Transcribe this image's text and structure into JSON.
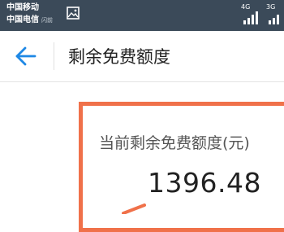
{
  "status_bar": {
    "carrier_1": "中国移动",
    "carrier_2": "中国电信",
    "carrier_2_tag": "闪前",
    "network_1": "4G",
    "network_2": "3G",
    "gallery_icon": "image-icon"
  },
  "header": {
    "back_icon": "back-arrow-icon",
    "title": "剩余免费额度"
  },
  "balance": {
    "label": "当前剩余免费额度(元)",
    "value": "1396.48"
  },
  "colors": {
    "status_bar_bg": "#3b4a59",
    "accent_blue": "#1e88e5",
    "highlight_orange": "#f0714a"
  }
}
